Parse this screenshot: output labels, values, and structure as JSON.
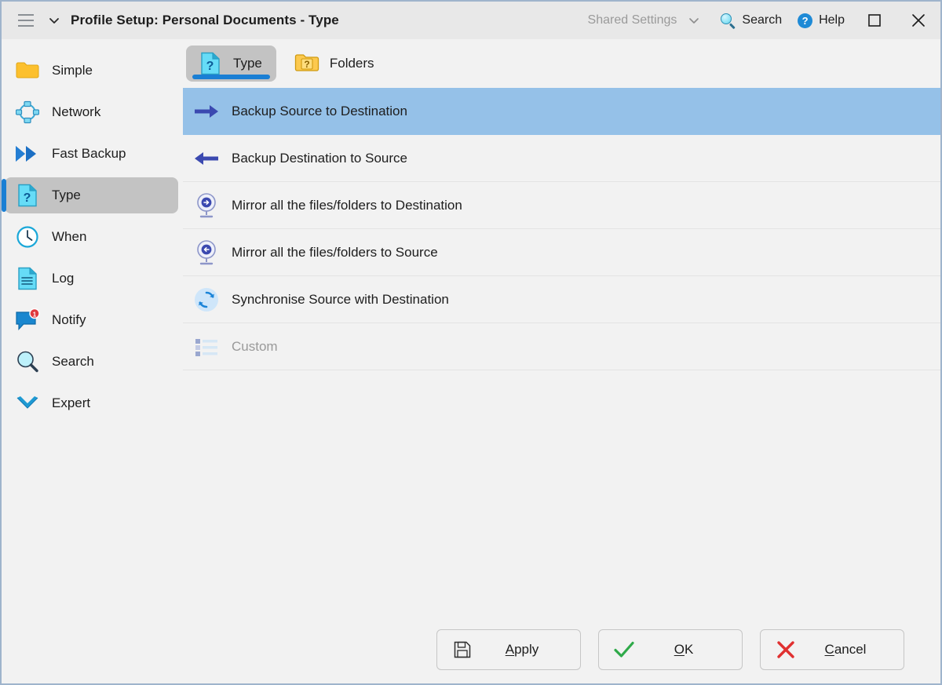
{
  "window": {
    "title": "Profile Setup: Personal Documents - Type",
    "menu_icon": "hamburger-icon",
    "title_chevron_icon": "chevron-down-icon"
  },
  "titlebar": {
    "shared_settings_label": "Shared Settings",
    "shared_settings_chevron_icon": "chevron-down-icon",
    "search_label": "Search",
    "search_icon": "magnifier-icon",
    "help_label": "Help",
    "help_icon": "help-circle-icon",
    "maximize_icon": "maximize-square-icon",
    "close_icon": "close-x-icon"
  },
  "sidebar": {
    "selected_index": 3,
    "items": [
      {
        "label": "Simple",
        "icon": "folder-icon"
      },
      {
        "label": "Network",
        "icon": "network-nodes-icon"
      },
      {
        "label": "Fast Backup",
        "icon": "double-arrow-right-icon"
      },
      {
        "label": "Type",
        "icon": "document-question-icon"
      },
      {
        "label": "When",
        "icon": "clock-icon"
      },
      {
        "label": "Log",
        "icon": "document-lines-icon"
      },
      {
        "label": "Notify",
        "icon": "speech-bubble-icon",
        "badge": "1"
      },
      {
        "label": "Search",
        "icon": "magnifier-icon"
      },
      {
        "label": "Expert",
        "icon": "chevron-double-down-icon"
      }
    ]
  },
  "content": {
    "tabs": [
      {
        "label": "Type",
        "icon": "document-question-icon",
        "active": true
      },
      {
        "label": "Folders",
        "icon": "folder-question-icon",
        "active": false
      }
    ],
    "type_options": [
      {
        "label": "Backup Source to Destination",
        "icon": "arrow-right-icon",
        "selected": true,
        "disabled": false
      },
      {
        "label": "Backup Destination to Source",
        "icon": "arrow-left-icon",
        "selected": false,
        "disabled": false
      },
      {
        "label": "Mirror all the files/folders to Destination",
        "icon": "mirror-right-icon",
        "selected": false,
        "disabled": false
      },
      {
        "label": "Mirror all the files/folders to Source",
        "icon": "mirror-left-icon",
        "selected": false,
        "disabled": false
      },
      {
        "label": "Synchronise Source with Destination",
        "icon": "sync-circular-icon",
        "selected": false,
        "disabled": false
      },
      {
        "label": "Custom",
        "icon": "list-bullets-icon",
        "selected": false,
        "disabled": true
      }
    ]
  },
  "footer": {
    "buttons": [
      {
        "name": "apply",
        "label": "Apply",
        "accel": "A",
        "icon": "floppy-save-icon"
      },
      {
        "name": "ok",
        "label": "OK",
        "accel": "O",
        "icon": "green-check-icon"
      },
      {
        "name": "cancel",
        "label": "Cancel",
        "accel": "C",
        "icon": "red-x-icon"
      }
    ]
  },
  "colors": {
    "accent_blue": "#1a7fd4",
    "selection_blue": "#95c1e8",
    "window_bg": "#f2f2f2",
    "titlebar_bg": "#e8e8e8",
    "selected_nav_bg": "#c3c3c3",
    "badge_red": "#e03a3e",
    "check_green": "#2faa4a",
    "cross_red": "#e03030"
  }
}
